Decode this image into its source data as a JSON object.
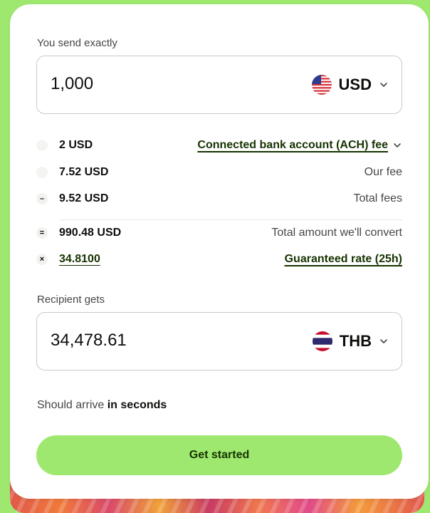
{
  "send": {
    "label": "You send exactly",
    "amount": "1,000",
    "currency": "USD",
    "flag_icon": "us-flag-icon"
  },
  "fees": [
    {
      "amount": "2 USD",
      "description": "Connected bank account (ACH) fee",
      "icon": "dot"
    },
    {
      "amount": "7.52 USD",
      "description": "Our fee",
      "icon": "dot"
    },
    {
      "amount": "9.52 USD",
      "description": "Total fees",
      "icon": "–"
    },
    {
      "amount": "990.48 USD",
      "description": "Total amount we'll convert",
      "icon": "="
    },
    {
      "amount": "34.8100",
      "description": "Guaranteed rate (25h)",
      "icon": "×"
    }
  ],
  "receive": {
    "label": "Recipient gets",
    "amount": "34,478.61",
    "currency": "THB",
    "flag_icon": "thailand-flag-icon"
  },
  "arrival": {
    "prefix": "Should arrive",
    "emphasis": "in seconds"
  },
  "cta": {
    "label": "Get started"
  },
  "colors": {
    "brand_green": "#9fe870",
    "link_green": "#163300",
    "text": "#0e0f0c",
    "muted": "#454745",
    "border": "#c9cbc6"
  }
}
